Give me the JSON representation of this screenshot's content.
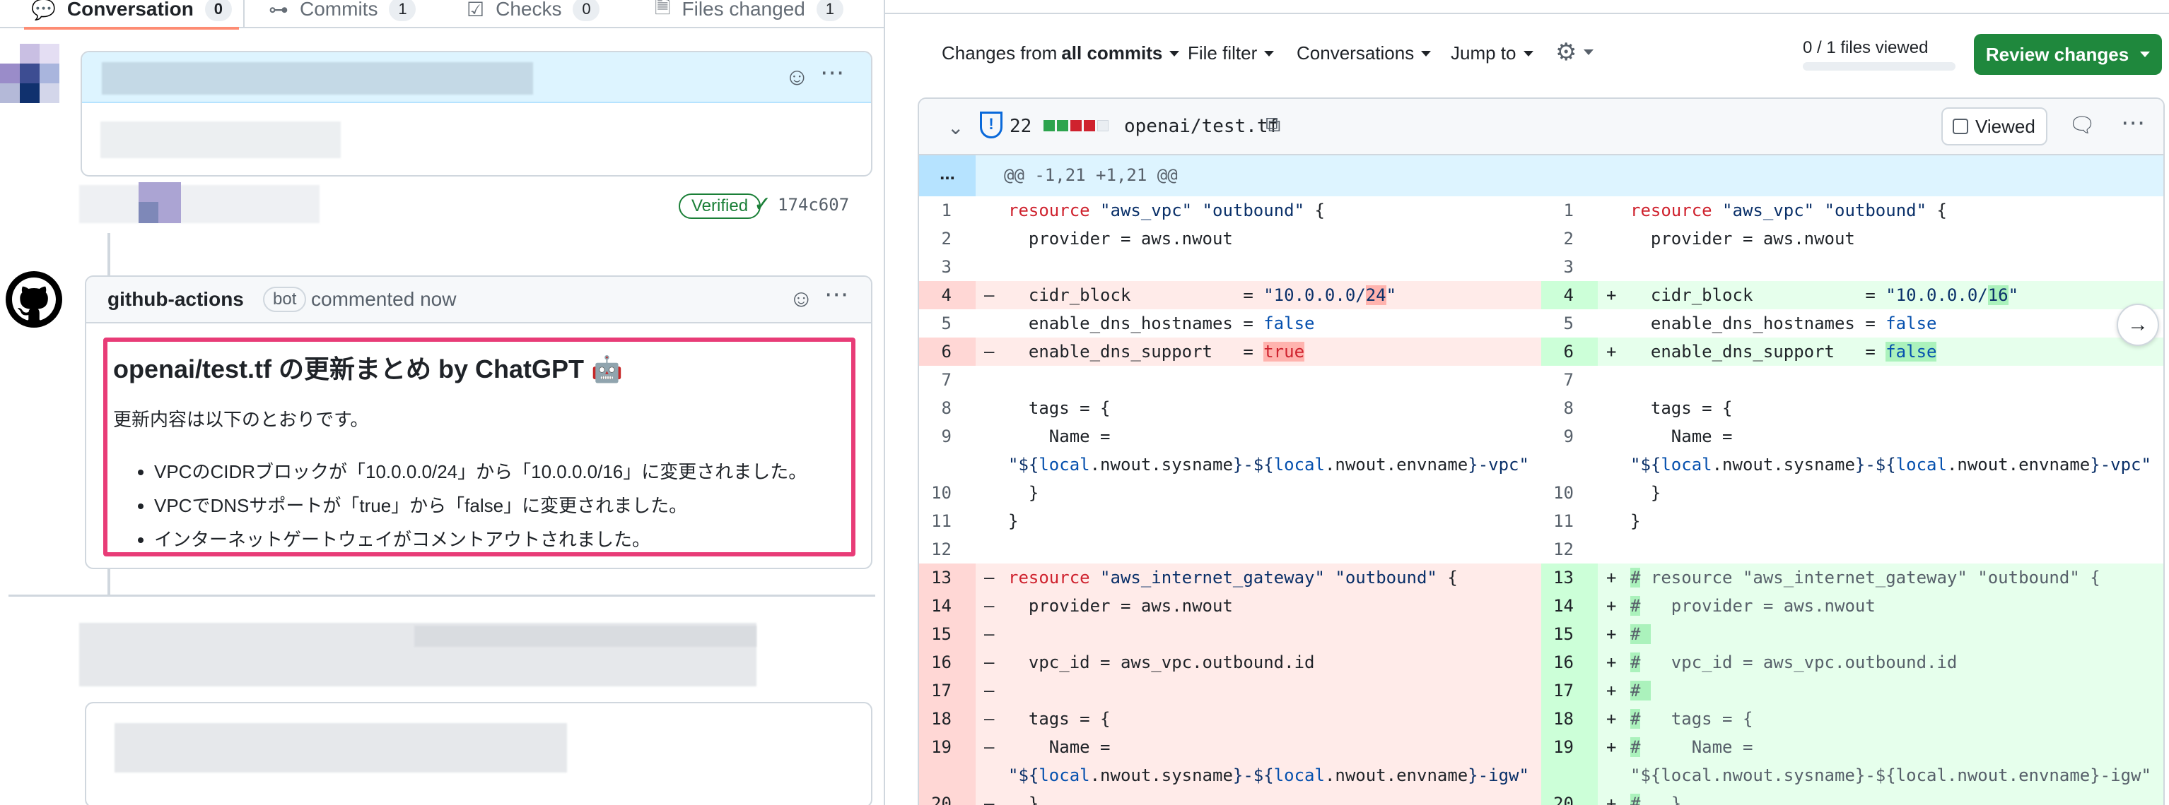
{
  "left": {
    "tabs": [
      {
        "label": "Conversation",
        "count": "0"
      },
      {
        "label": "Commits",
        "count": "1"
      },
      {
        "label": "Checks",
        "count": "0"
      },
      {
        "label": "Files changed",
        "count": "1"
      }
    ],
    "verified_label": "Verified",
    "commit_hash": "174c607",
    "comment": {
      "author": "github-actions",
      "badge": "bot",
      "meta": "commented now",
      "title": "openai/test.tf の更新まとめ by ChatGPT 🤖",
      "intro": "更新内容は以下のとおりです。",
      "items": [
        "VPCのCIDRブロックが「10.0.0.0/24」から「10.0.0.0/16」に変更されました。",
        "VPCでDNSサポートが「true」から「false」に変更されました。",
        "インターネットゲートウェイがコメントアウトされました。"
      ]
    }
  },
  "right": {
    "toolbar": {
      "changes_from_prefix": "Changes from",
      "changes_from_value": "all commits",
      "file_filter": "File filter",
      "conversations": "Conversations",
      "jump_to": "Jump to"
    },
    "files_viewed": "0 / 1 files viewed",
    "review_button": "Review changes",
    "file": {
      "change_count": "22",
      "name": "openai/test.tf",
      "viewed_label": "Viewed"
    },
    "hunk_expand": "...",
    "hunk_header": "@@ -1,21 +1,21 @@"
  },
  "colors": {
    "add": "#e6ffec",
    "del": "#ffebe9",
    "accent_green": "#1f883d",
    "highlight_border": "#e83c77"
  }
}
